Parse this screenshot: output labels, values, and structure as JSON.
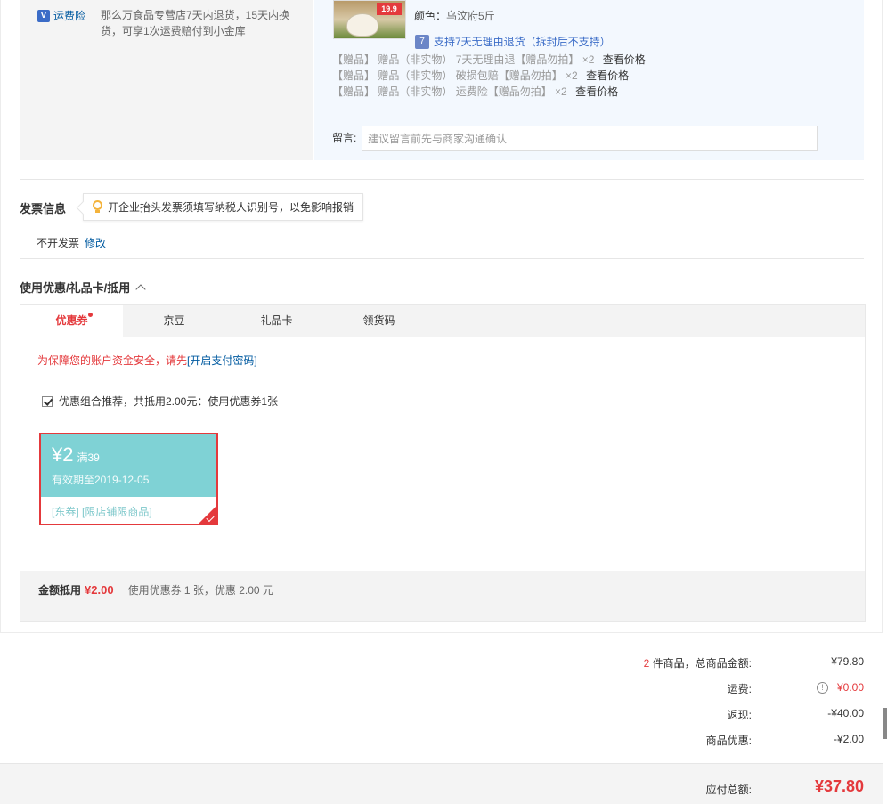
{
  "order": {
    "freight_insurance_label": "运费险",
    "freight_insurance_desc": "那么万食品专营店7天内退货，15天内换货，可享1次运费赔付到小金库",
    "product_tag": "19.9",
    "color_label": "颜色：",
    "color_value": "乌汶府5斤",
    "return_policy": "支持7天无理由退货（拆封后不支持）",
    "return_icon": "7",
    "gifts": [
      {
        "prefix": "【赠品】",
        "name": "赠品（非实物） 7天无理由退【赠品勿拍】 ×2",
        "action": "查看价格"
      },
      {
        "prefix": "【赠品】",
        "name": "赠品（非实物） 破损包赔【赠品勿拍】 ×2",
        "action": "查看价格"
      },
      {
        "prefix": "【赠品】",
        "name": "赠品（非实物） 运费险【赠品勿拍】 ×2",
        "action": "查看价格"
      }
    ],
    "remark_label": "留言:",
    "remark_placeholder": "建议留言前先与商家沟通确认"
  },
  "invoice": {
    "title": "发票信息",
    "tip": "开企业抬头发票须填写纳税人识别号，以免影响报销",
    "value": "不开发票",
    "edit": "修改"
  },
  "coupons": {
    "title": "使用优惠/礼品卡/抵用",
    "tabs": [
      "优惠券",
      "京豆",
      "礼品卡",
      "领货码"
    ],
    "security_tip": "为保障您的账户资金安全，请先",
    "security_link": "[开启支付密码]",
    "combo_text": "优惠组合推荐，共抵用2.00元：使用优惠券1张",
    "card": {
      "amount": "¥2",
      "condition": "满39",
      "valid": "有效期至2019-12-05",
      "tags": "[东券] [限店铺限商品]"
    },
    "deduct_label": "金额抵用",
    "deduct_value": "¥2.00",
    "deduct_desc": "使用优惠券 1 张，优惠 2.00 元"
  },
  "summary": {
    "count": "2",
    "count_label": " 件商品，总商品金额:",
    "goods_amount": "¥79.80",
    "freight_label": "运费:",
    "freight_value": "¥0.00",
    "rebate_label": "返现:",
    "rebate_value": "-¥40.00",
    "discount_label": "商品优惠:",
    "discount_value": "-¥2.00",
    "total_label": "应付总额:",
    "total_value": "¥37.80"
  },
  "colors": {
    "accent_red": "#e4393c",
    "link_blue": "#005aa0",
    "coupon_teal": "#7fd2d5"
  }
}
